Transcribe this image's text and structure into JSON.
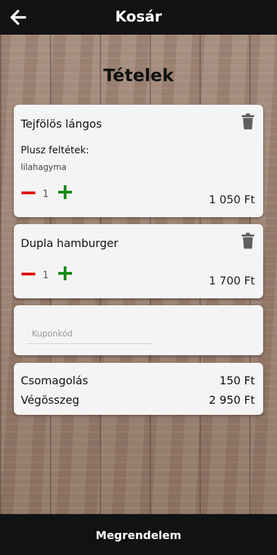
{
  "header": {
    "title": "Kosár",
    "back_icon": "arrow-left-icon"
  },
  "page": {
    "title": "Tételek"
  },
  "cart": {
    "items": [
      {
        "name": "Tejfölös lángos",
        "extras_label": "Plusz feltétek:",
        "extras": "lilahagyma",
        "quantity": "1",
        "price": "1 050 Ft"
      },
      {
        "name": "Dupla hamburger",
        "quantity": "1",
        "price": "1 700 Ft"
      }
    ]
  },
  "coupon": {
    "placeholder": "Kuponkód",
    "value": ""
  },
  "summary": {
    "packaging_label": "Csomagolás",
    "packaging_value": "150 Ft",
    "total_label": "Végösszeg",
    "total_value": "2 950 Ft"
  },
  "footer": {
    "order_button_label": "Megrendelem"
  },
  "colors": {
    "bar_background": "#121212",
    "card_background": "#f4f4f4",
    "minus_red": "#e01010",
    "plus_green": "#1a8a1a",
    "trash_gray": "#5f5f5f"
  },
  "icons": {
    "trash": "trash-icon",
    "minus": "minus-icon",
    "plus": "plus-icon"
  }
}
